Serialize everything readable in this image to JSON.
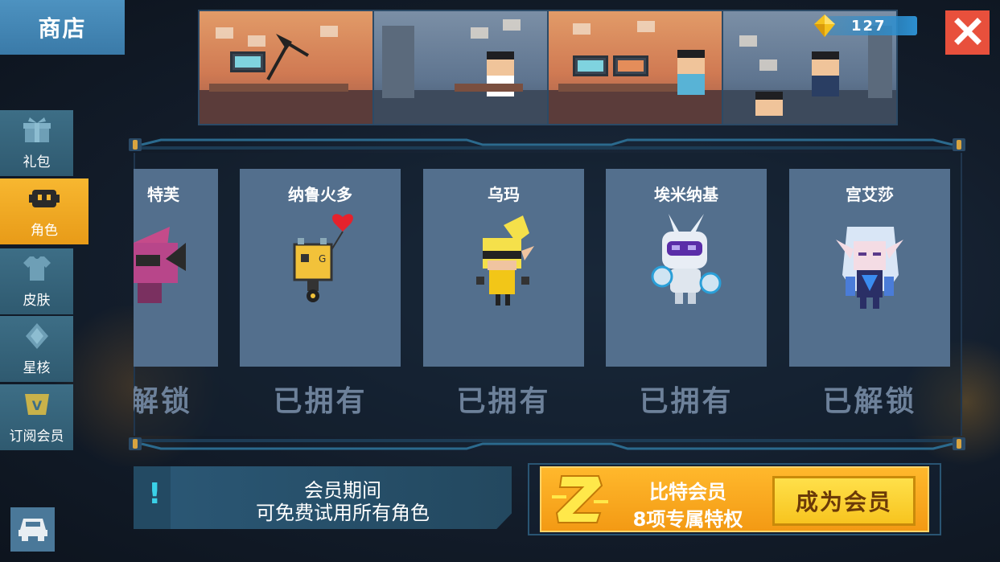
{
  "header": {
    "shop_title": "商店",
    "gem_count": "127"
  },
  "sidebar": {
    "items": [
      {
        "label": "礼包",
        "icon": "gift-icon"
      },
      {
        "label": "角色",
        "icon": "character-face-icon",
        "active": true
      },
      {
        "label": "皮肤",
        "icon": "shirt-icon"
      },
      {
        "label": "星核",
        "icon": "star-core-icon"
      },
      {
        "label": "订阅会员",
        "icon": "vip-badge-icon"
      }
    ]
  },
  "characters": [
    {
      "name": "特芙",
      "status": "解锁"
    },
    {
      "name": "纳鲁火多",
      "status": "已拥有"
    },
    {
      "name": "乌玛",
      "status": "已拥有"
    },
    {
      "name": "埃米纳基",
      "status": "已拥有"
    },
    {
      "name": "宫艾莎",
      "status": "已解锁"
    }
  ],
  "member_info": {
    "line1": "会员期间",
    "line2": "可免费试用所有角色"
  },
  "vip": {
    "title": "比特会员",
    "subtitle": "8项专属特权",
    "button": "成为会员"
  },
  "colors": {
    "accent_orange": "#f39a14",
    "sidebar_blue": "#3d6e86",
    "close_red": "#e8503c",
    "card_blue": "#536f8d"
  }
}
